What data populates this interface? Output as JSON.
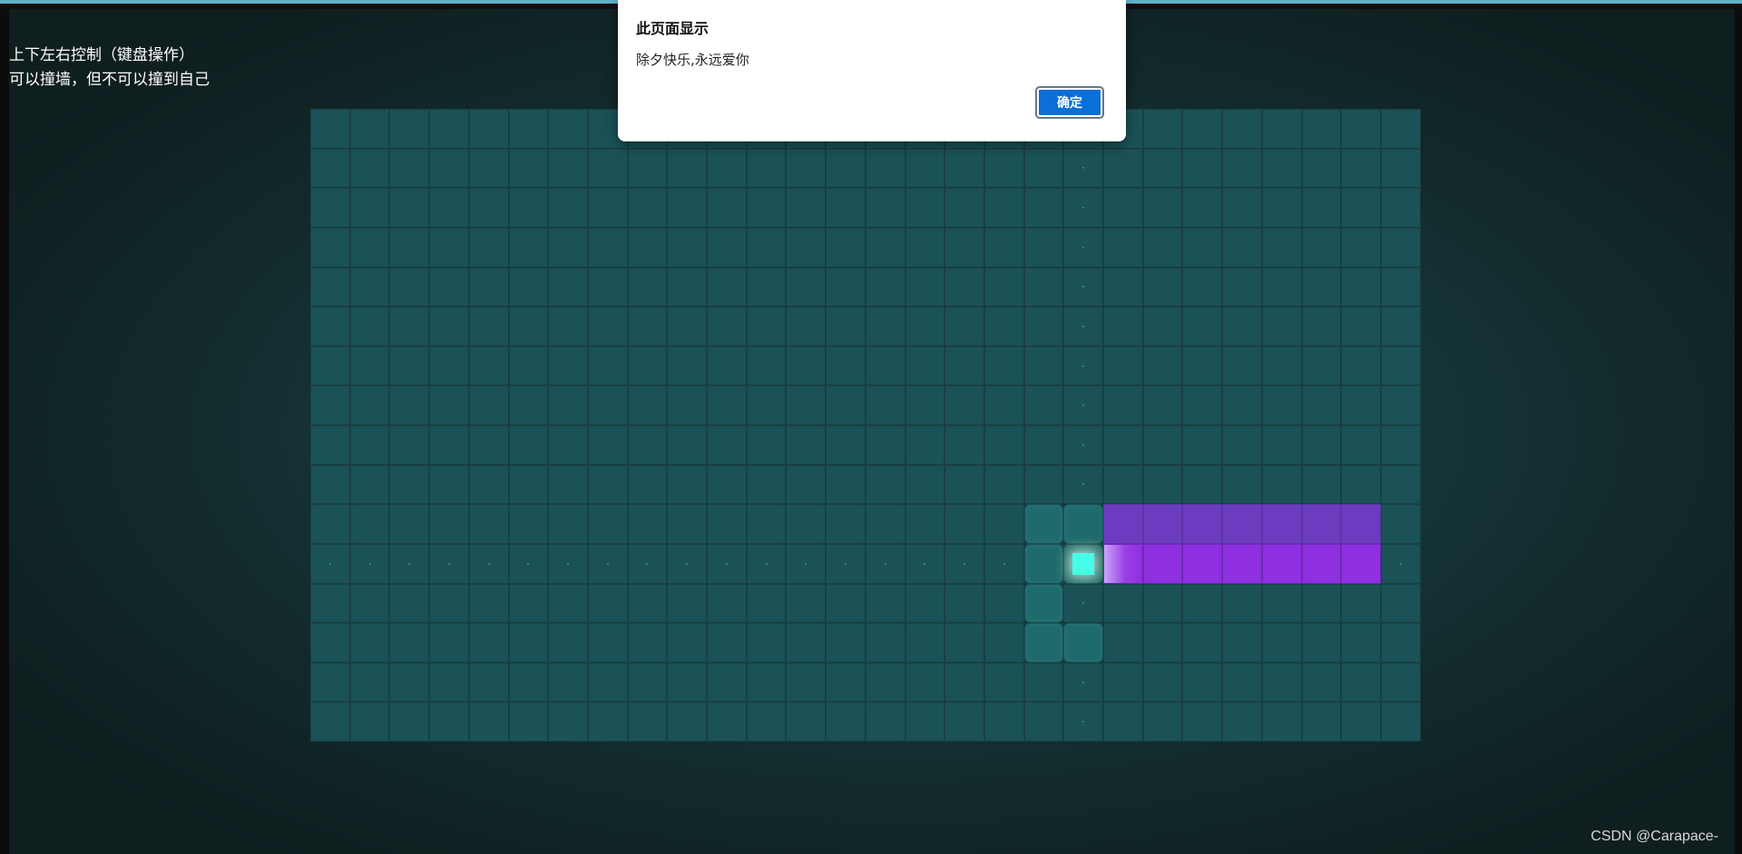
{
  "instructions": {
    "line1": "上下左右控制（键盘操作）",
    "line2": "可以撞墙，但不可以撞到自己"
  },
  "alert": {
    "title": "此页面显示",
    "message": "除夕快乐,永远爱你",
    "ok_label": "确定"
  },
  "watermark": "CSDN @Carapace-",
  "board": {
    "columns": 28,
    "rows": 16,
    "trail_cells": [
      [
        10,
        18
      ],
      [
        10,
        19
      ],
      [
        11,
        18
      ],
      [
        12,
        18
      ],
      [
        13,
        18
      ],
      [
        13,
        19
      ]
    ],
    "head_cell": [
      11,
      19
    ],
    "purple_top_cells": [
      [
        10,
        20
      ],
      [
        10,
        21
      ],
      [
        10,
        22
      ],
      [
        10,
        23
      ],
      [
        10,
        24
      ],
      [
        10,
        25
      ],
      [
        10,
        26
      ]
    ],
    "purple_body_cells": [
      [
        11,
        21
      ],
      [
        11,
        22
      ],
      [
        11,
        23
      ],
      [
        11,
        24
      ],
      [
        11,
        25
      ],
      [
        11,
        26
      ]
    ],
    "purple_glow_cells": [
      [
        11,
        20
      ]
    ],
    "dot_cells": "row 11 and column 19"
  },
  "colors": {
    "board_cell": "#1a5258",
    "purple": "#8e2fe0",
    "food": "#47ffe9",
    "button": "#0a6fd6"
  }
}
